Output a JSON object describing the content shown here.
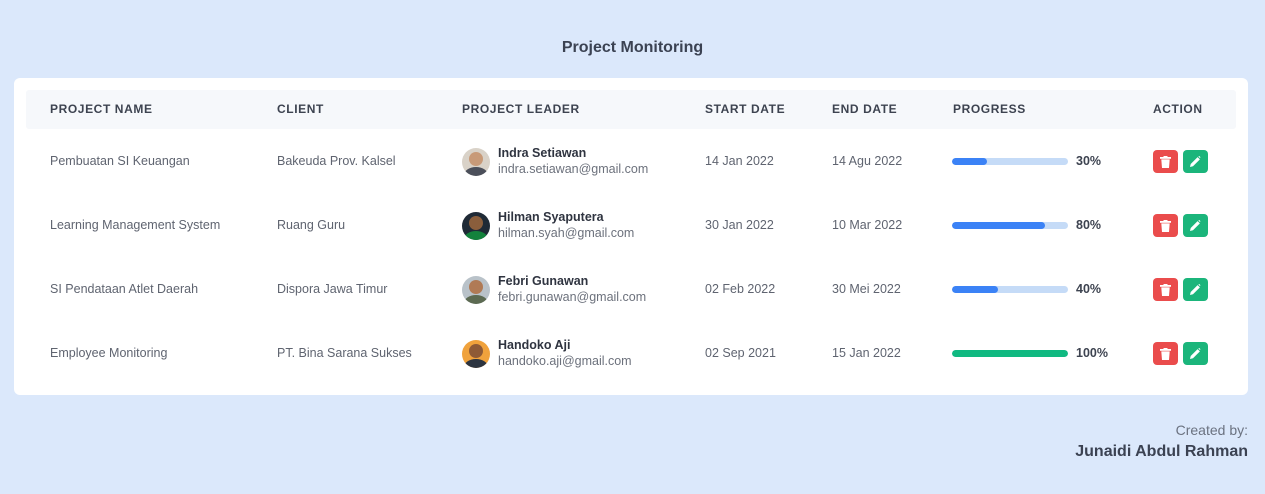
{
  "page": {
    "title": "Project Monitoring"
  },
  "table": {
    "headers": [
      "PROJECT NAME",
      "CLIENT",
      "PROJECT LEADER",
      "START DATE",
      "END DATE",
      "PROGRESS",
      "ACTION"
    ],
    "rows": [
      {
        "project_name": "Pembuatan SI Keuangan",
        "client": "Bakeuda Prov. Kalsel",
        "leader_name": "Indra Setiawan",
        "leader_email": "indra.setiawan@gmail.com",
        "start_date": "14 Jan 2022",
        "end_date": "14 Agu 2022",
        "progress": 30,
        "progress_label": "30%",
        "progress_color": "#3b82f6"
      },
      {
        "project_name": "Learning Management System",
        "client": "Ruang Guru",
        "leader_name": "Hilman Syaputera",
        "leader_email": "hilman.syah@gmail.com",
        "start_date": "30 Jan 2022",
        "end_date": "10 Mar 2022",
        "progress": 80,
        "progress_label": "80%",
        "progress_color": "#3b82f6"
      },
      {
        "project_name": "SI Pendataan Atlet Daerah",
        "client": "Dispora Jawa Timur",
        "leader_name": "Febri Gunawan",
        "leader_email": "febri.gunawan@gmail.com",
        "start_date": "02 Feb 2022",
        "end_date": "30 Mei 2022",
        "progress": 40,
        "progress_label": "40%",
        "progress_color": "#3b82f6"
      },
      {
        "project_name": "Employee Monitoring",
        "client": "PT. Bina Sarana Sukses",
        "leader_name": "Handoko Aji",
        "leader_email": "handoko.aji@gmail.com",
        "start_date": "02 Sep 2021",
        "end_date": "15 Jan 2022",
        "progress": 100,
        "progress_label": "100%",
        "progress_color": "#10b981"
      }
    ]
  },
  "colors": {
    "background": "#dbe8fb",
    "progress_track": "#c5dbf7",
    "delete_button": "#ea4c4c",
    "edit_button": "#1bb57b"
  },
  "actions": {
    "delete_icon": "trash-icon",
    "edit_icon": "pencil-icon"
  },
  "footer": {
    "created_label": "Created by:",
    "author": "Junaidi Abdul Rahman"
  }
}
